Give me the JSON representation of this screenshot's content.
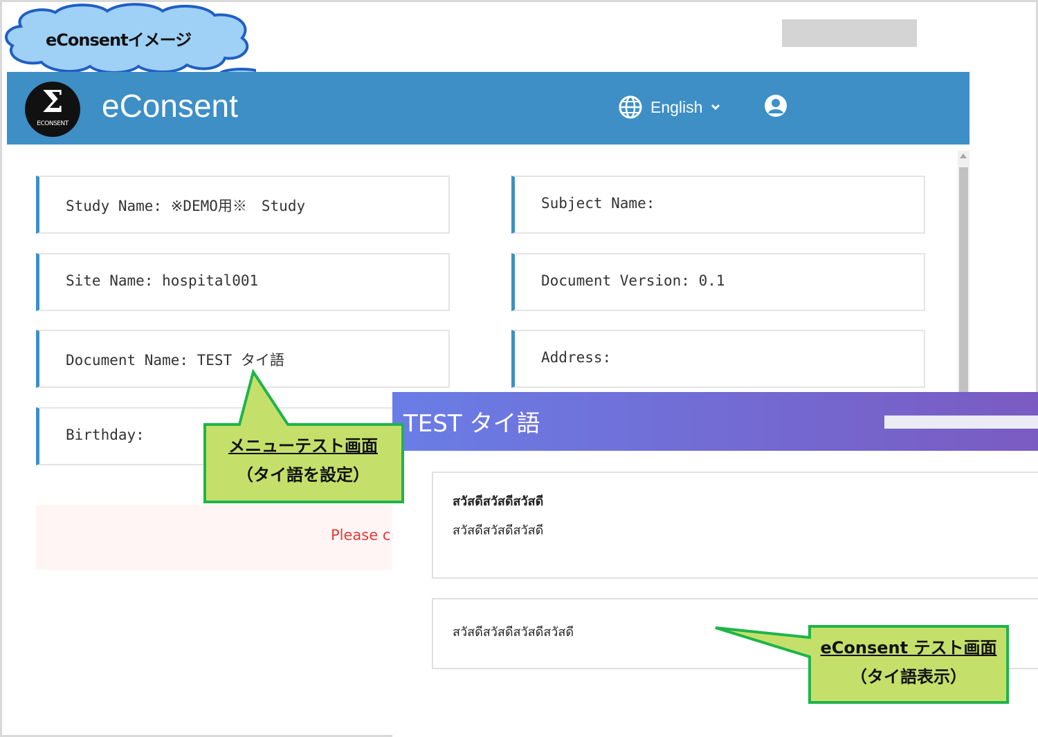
{
  "annotation_cloud": "eConsentイメージ",
  "header": {
    "logo_text": "ECONSENT",
    "title": "eConsent",
    "language": "English",
    "user_name": ""
  },
  "info": {
    "study_name": "Study Name: ※DEMO用※　Study",
    "subject_name": "Subject Name:",
    "site_name": "Site Name: hospital001",
    "document_version": "Document Version: 0.1",
    "document_name": "Document Name: TEST タイ語",
    "address": "Address:",
    "birthday": "Birthday:"
  },
  "alert": {
    "text": "Please c"
  },
  "document_modal": {
    "title": "TEST タイ語",
    "section1_heading": "สวัสดีสวัสดีสวัสดี",
    "section1_body": "สวัสดีสวัสดีสวัสดี",
    "section2_body": "สวัสดีสวัสดีสวัสดีสวัสดี"
  },
  "callouts": {
    "menu_test_line1": "メニューテスト画面",
    "menu_test_line2": "（タイ語を設定）",
    "econsent_test_line1": "eConsent テスト画面",
    "econsent_test_line2": "（タイ語表示）"
  },
  "colors": {
    "header_blue": "#3d8fc6",
    "callout_green": "#c5e06a",
    "callout_border": "#1fb44a",
    "cloud_fill": "#9fd0f5",
    "cloud_border": "#1f5fc4",
    "alert_red": "#e53935"
  }
}
